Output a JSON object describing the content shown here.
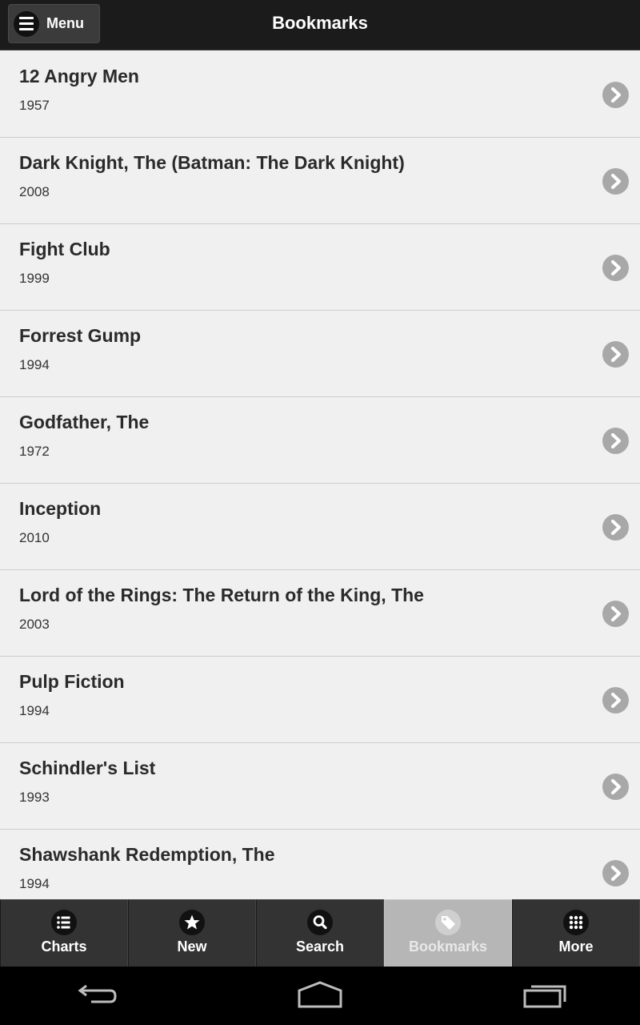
{
  "header": {
    "menu_label": "Menu",
    "title": "Bookmarks"
  },
  "bookmarks": [
    {
      "title": "12 Angry Men",
      "year": "1957"
    },
    {
      "title": "Dark Knight, The (Batman: The Dark Knight)",
      "year": "2008"
    },
    {
      "title": "Fight Club",
      "year": "1999"
    },
    {
      "title": "Forrest Gump",
      "year": "1994"
    },
    {
      "title": "Godfather, The",
      "year": "1972"
    },
    {
      "title": "Inception",
      "year": "2010"
    },
    {
      "title": "Lord of the Rings: The Return of the King, The",
      "year": "2003"
    },
    {
      "title": "Pulp Fiction",
      "year": "1994"
    },
    {
      "title": "Schindler's List",
      "year": "1993"
    },
    {
      "title": "Shawshank Redemption, The",
      "year": "1994"
    }
  ],
  "tabs": [
    {
      "label": "Charts",
      "icon": "list-icon"
    },
    {
      "label": "New",
      "icon": "star-icon"
    },
    {
      "label": "Search",
      "icon": "search-icon"
    },
    {
      "label": "Bookmarks",
      "icon": "tag-icon",
      "active": true
    },
    {
      "label": "More",
      "icon": "grid-icon"
    }
  ],
  "system_nav": {
    "buttons": [
      "back-icon",
      "home-icon",
      "recent-apps-icon"
    ]
  },
  "colors": {
    "header_bg": "#1b1b1b",
    "list_bg": "#f0f0f0",
    "tab_bg": "#333333",
    "tab_active_bg": "#b6b6b6",
    "chevron_bg": "#a8a8a8"
  }
}
